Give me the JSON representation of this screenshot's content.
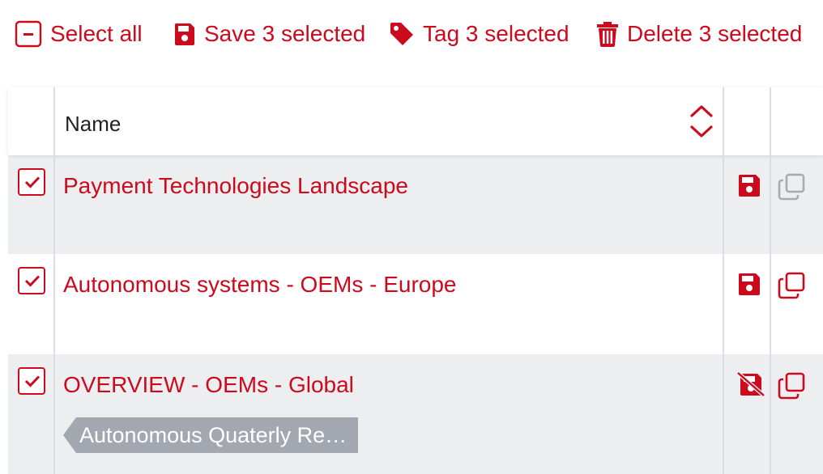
{
  "toolbar": {
    "select_all": {
      "label": "Select all",
      "icon": "minus-square-icon"
    },
    "save": {
      "label": "Save 3 selected",
      "icon": "floppy-disk-icon"
    },
    "tag": {
      "label": "Tag 3 selected",
      "icon": "tag-icon"
    },
    "delete": {
      "label": "Delete 3 selected",
      "icon": "trash-icon"
    }
  },
  "table": {
    "columns": {
      "name": "Name",
      "sort_icon": "sort-up-down-icon"
    },
    "rows": [
      {
        "name": "Payment Technologies Landscape",
        "checked": true,
        "save_icon": "floppy-disk-icon",
        "copy_icon": "copy-icon-disabled",
        "tag": ""
      },
      {
        "name": "Autonomous systems - OEMs - Europe",
        "checked": true,
        "save_icon": "floppy-disk-icon",
        "copy_icon": "copy-icon",
        "tag": ""
      },
      {
        "name": "OVERVIEW - OEMs - Global",
        "checked": true,
        "save_icon": "floppy-disk-off-icon",
        "copy_icon": "copy-icon",
        "tag": "Autonomous Quaterly Re…"
      }
    ]
  },
  "colors": {
    "accent": "#cc0a1e",
    "row_alt_bg": "#edeef0",
    "tag_bg": "#a3a8b0",
    "disabled_icon": "#a6abb3"
  }
}
